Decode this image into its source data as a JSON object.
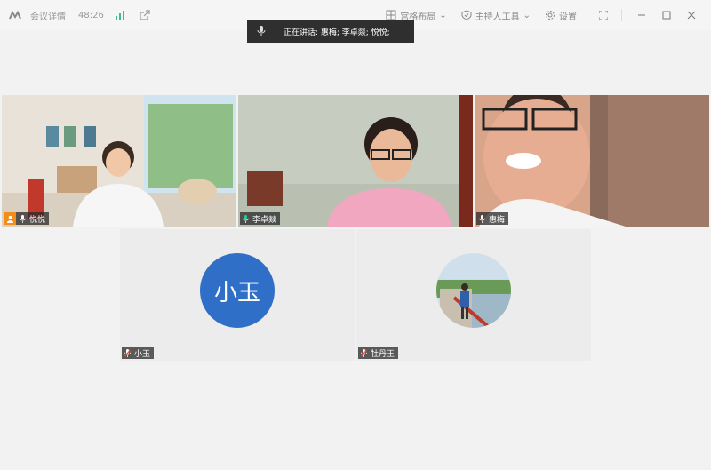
{
  "titlebar": {
    "meeting_details": "会议详情",
    "timer": "48:26",
    "layout_label": "宫格布局",
    "host_tools_label": "主持人工具",
    "settings_label": "设置"
  },
  "speaking_banner": {
    "text": "正在讲话:  惠梅; 李卓燚; 悦悦;"
  },
  "participants": [
    {
      "name": "悦悦",
      "host": true,
      "mic": "on",
      "type": "video"
    },
    {
      "name": "李卓燚",
      "host": false,
      "mic": "speaking",
      "type": "video"
    },
    {
      "name": "惠梅",
      "host": false,
      "mic": "on",
      "type": "video",
      "active_speaker": true
    },
    {
      "name": "小玉",
      "host": false,
      "mic": "muted",
      "type": "avatar",
      "avatar_text": "小玉",
      "avatar_color": "#2f6fc8"
    },
    {
      "name": "牡丹王",
      "host": false,
      "mic": "muted",
      "type": "avatar-photo"
    }
  ],
  "colors": {
    "active_border": "#36c28a",
    "host_badge": "#f28c1a",
    "avatar_blue": "#2f6fc8"
  }
}
